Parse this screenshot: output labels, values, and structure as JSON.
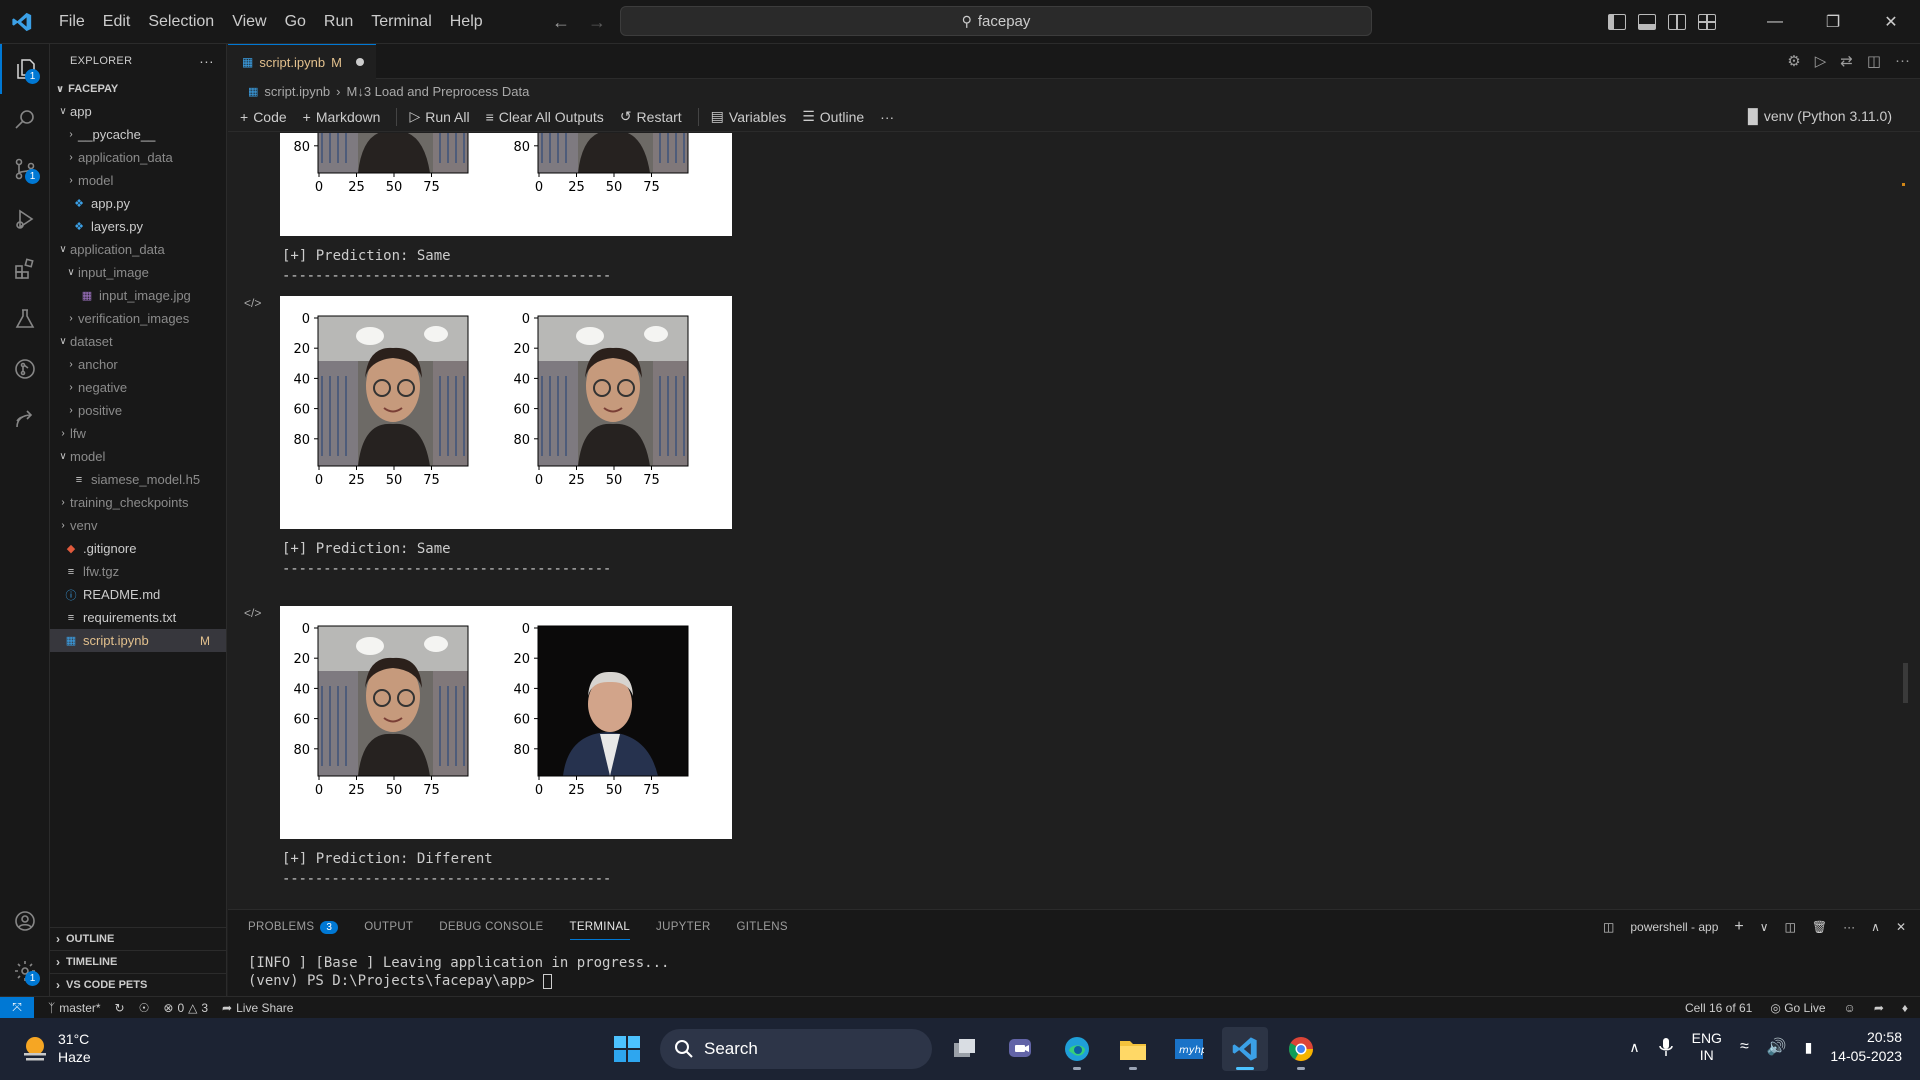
{
  "titlebar": {
    "menu": [
      "File",
      "Edit",
      "Selection",
      "View",
      "Go",
      "Run",
      "Terminal",
      "Help"
    ],
    "search_text": "facepay",
    "accent": "#0078d4"
  },
  "activity": {
    "icons": [
      "explorer-icon",
      "search-icon",
      "source-control-icon",
      "run-debug-icon",
      "extensions-icon",
      "testing-icon",
      "gitlens-icon",
      "live-share-icon"
    ],
    "explorer_badge": "1",
    "source_control_badge": "1",
    "settings_badge": "1"
  },
  "sidebar": {
    "title": "EXPLORER",
    "root": "FACEPAY",
    "tree": [
      {
        "label": "app",
        "indent": 1,
        "type": "folder-open",
        "muted": false
      },
      {
        "label": "__pycache__",
        "indent": 2,
        "type": "folder",
        "muted": false
      },
      {
        "label": "application_data",
        "indent": 2,
        "type": "folder",
        "muted": true
      },
      {
        "label": "model",
        "indent": 2,
        "type": "folder",
        "muted": true
      },
      {
        "label": "app.py",
        "indent": 2,
        "type": "py",
        "muted": false
      },
      {
        "label": "layers.py",
        "indent": 2,
        "type": "py",
        "muted": false
      },
      {
        "label": "application_data",
        "indent": 1,
        "type": "folder-open",
        "muted": true
      },
      {
        "label": "input_image",
        "indent": 2,
        "type": "folder-open",
        "muted": true
      },
      {
        "label": "input_image.jpg",
        "indent": 3,
        "type": "img",
        "muted": true
      },
      {
        "label": "verification_images",
        "indent": 2,
        "type": "folder",
        "muted": true
      },
      {
        "label": "dataset",
        "indent": 1,
        "type": "folder-open",
        "muted": true
      },
      {
        "label": "anchor",
        "indent": 2,
        "type": "folder",
        "muted": true
      },
      {
        "label": "negative",
        "indent": 2,
        "type": "folder",
        "muted": true
      },
      {
        "label": "positive",
        "indent": 2,
        "type": "folder",
        "muted": true
      },
      {
        "label": "lfw",
        "indent": 1,
        "type": "folder",
        "muted": true
      },
      {
        "label": "model",
        "indent": 1,
        "type": "folder-open",
        "muted": true
      },
      {
        "label": "siamese_model.h5",
        "indent": 2,
        "type": "file",
        "muted": true
      },
      {
        "label": "training_checkpoints",
        "indent": 1,
        "type": "folder",
        "muted": true
      },
      {
        "label": "venv",
        "indent": 1,
        "type": "folder",
        "muted": true
      },
      {
        "label": ".gitignore",
        "indent": 1,
        "type": "git",
        "muted": false
      },
      {
        "label": "lfw.tgz",
        "indent": 1,
        "type": "file",
        "muted": true
      },
      {
        "label": "README.md",
        "indent": 1,
        "type": "info",
        "muted": false
      },
      {
        "label": "requirements.txt",
        "indent": 1,
        "type": "file",
        "muted": false
      },
      {
        "label": "script.ipynb",
        "indent": 1,
        "type": "nb",
        "muted": false,
        "selected": true,
        "mark": "M"
      }
    ],
    "sections": [
      "OUTLINE",
      "TIMELINE",
      "VS CODE PETS"
    ]
  },
  "editor": {
    "tab_label": "script.ipynb",
    "tab_mark": "M",
    "breadcrumb_file": "script.ipynb",
    "breadcrumb_section": "M↓3 Load and Preprocess Data",
    "toolbar": {
      "code": "Code",
      "markdown": "Markdown",
      "run_all": "Run All",
      "clear": "Clear All Outputs",
      "restart": "Restart",
      "variables": "Variables",
      "outline": "Outline",
      "more": "···",
      "kernel": "venv (Python 3.11.0)"
    }
  },
  "outputs": {
    "y_ticks": [
      "0",
      "20",
      "40",
      "60",
      "80"
    ],
    "x_ticks": [
      "0",
      "25",
      "50",
      "75"
    ],
    "predictions": [
      "[+] Prediction: Same",
      "[+] Prediction: Same",
      "[+] Prediction: Different"
    ],
    "divider": "----------------------------------------"
  },
  "panel": {
    "tabs": [
      "PROBLEMS",
      "OUTPUT",
      "DEBUG CONSOLE",
      "TERMINAL",
      "JUPYTER",
      "GITLENS"
    ],
    "problems_count": "3",
    "terminal_name": "powershell - app",
    "line1": "[INFO   ] [Base        ] Leaving application in progress...",
    "prompt": "(venv) PS D:\\Projects\\facepay\\app> "
  },
  "statusbar": {
    "branch": "master*",
    "errors": "0",
    "warnings": "3",
    "live_share": "Live Share",
    "cell": "Cell 16 of 61",
    "go_live": "Go Live"
  },
  "taskbar": {
    "temp": "31°C",
    "weather": "Haze",
    "search": "Search",
    "lang1": "ENG",
    "lang2": "IN",
    "time": "20:58",
    "date": "14-05-2023"
  }
}
